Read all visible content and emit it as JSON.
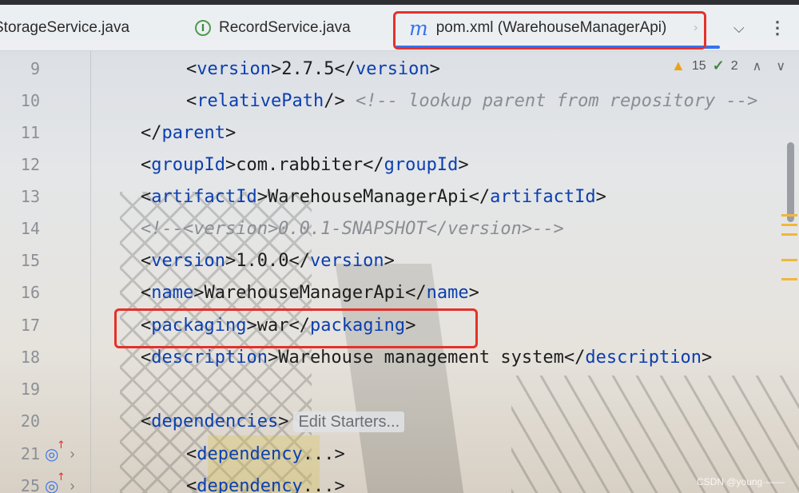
{
  "tabs": [
    {
      "label": "StorageService.java"
    },
    {
      "label": "RecordService.java",
      "icon": "interface-icon",
      "icon_glyph": "I"
    },
    {
      "label": "pom.xml (WarehouseManagerApi)",
      "icon": "maven-icon",
      "icon_glyph": "m",
      "active": true
    }
  ],
  "inspections": {
    "warnings": "15",
    "weak_warnings": "2"
  },
  "editor": {
    "lines": [
      {
        "num": "9"
      },
      {
        "num": "10"
      },
      {
        "num": "11"
      },
      {
        "num": "12"
      },
      {
        "num": "13"
      },
      {
        "num": "14"
      },
      {
        "num": "15"
      },
      {
        "num": "16"
      },
      {
        "num": "17"
      },
      {
        "num": "18"
      },
      {
        "num": "19"
      },
      {
        "num": "20"
      },
      {
        "num": "21"
      },
      {
        "num": "25"
      }
    ],
    "version_value": "2.7.5",
    "relative_path_comment": "<!-- lookup parent from repository -->",
    "group_id": "com.rabbiter",
    "artifact_id": "WarehouseManagerApi",
    "commented_version": "<!--<version>0.0.1-SNAPSHOT</version>-->",
    "version": "1.0.0",
    "name": "WarehouseManagerApi",
    "packaging": "war",
    "description": "Warehouse management system",
    "edit_starters": "Edit Starters...",
    "collapsed": "..."
  },
  "watermark": "CSDN @young·——",
  "colors": {
    "accent": "#3574f0",
    "highlight": "#e5312a",
    "tag": "#0b3fb0"
  }
}
